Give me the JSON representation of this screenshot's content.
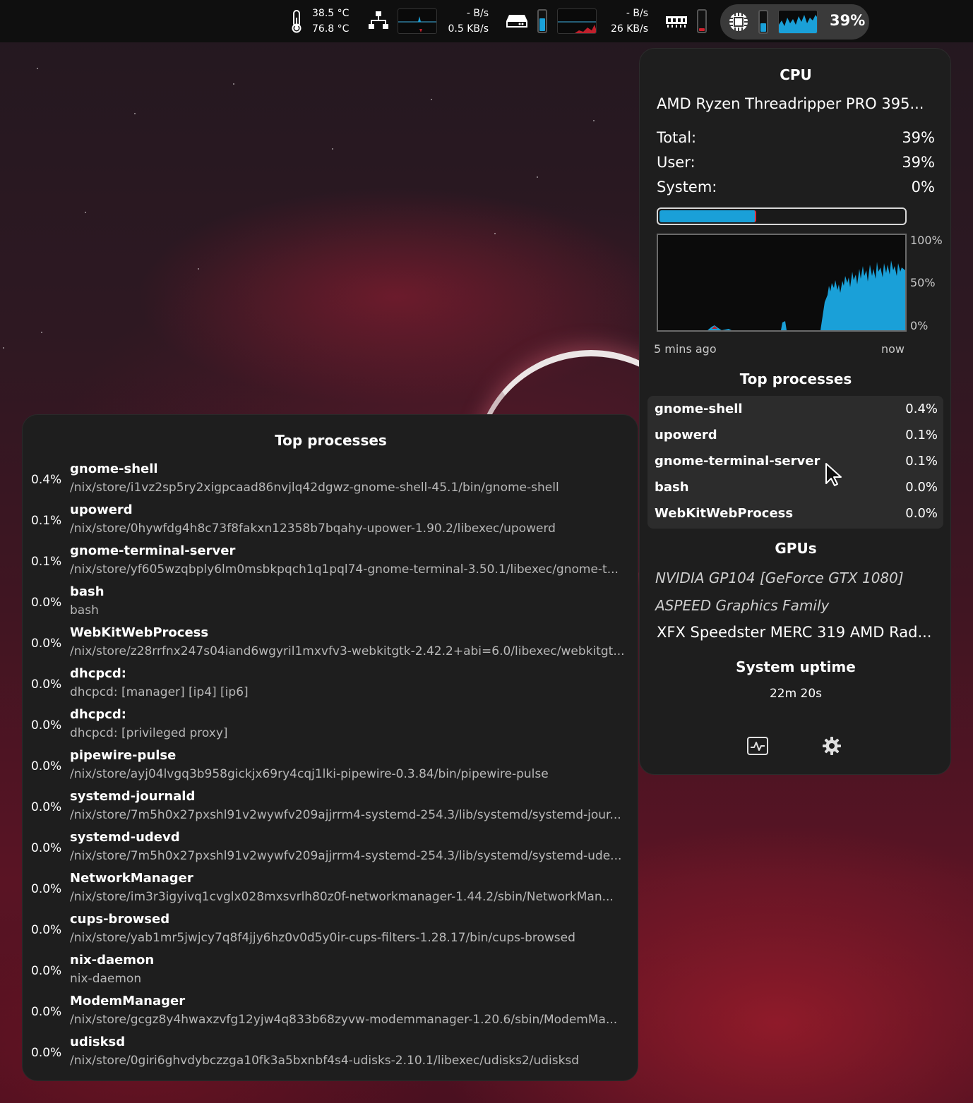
{
  "topbar": {
    "temp1": "38.5 °C",
    "temp2": "76.8 °C",
    "net_up": "-  B/s",
    "net_down": "0.5 KB/s",
    "disk_read": "- B/s",
    "disk_write": "26 KB/s",
    "cpu_percent": "39%",
    "memory_fill": 0.35,
    "swap_fill": 0.15,
    "cpu_mini_fill": 0.39,
    "icons": [
      "thermometer-icon",
      "network-icon",
      "disk-icon",
      "memory-icon",
      "cpu-icon"
    ]
  },
  "cpu_panel": {
    "title": "CPU",
    "model": "AMD Ryzen Threadripper PRO 395...",
    "total_label": "Total:",
    "total_value": "39%",
    "user_label": "User:",
    "user_value": "39%",
    "system_label": "System:",
    "system_value": "0%",
    "usage_fraction": 0.39,
    "graph_ylabels": [
      "100%",
      "50%",
      "0%"
    ],
    "graph_xlabel_left": "5 mins ago",
    "graph_xlabel_right": "now",
    "top_title": "Top processes",
    "top": [
      {
        "name": "gnome-shell",
        "pct": "0.4%"
      },
      {
        "name": "upowerd",
        "pct": "0.1%"
      },
      {
        "name": "gnome-terminal-server",
        "pct": "0.1%"
      },
      {
        "name": "bash",
        "pct": "0.0%"
      },
      {
        "name": "WebKitWebProcess",
        "pct": "0.0%"
      }
    ],
    "gpus_title": "GPUs",
    "gpus": [
      "NVIDIA GP104 [GeForce GTX 1080]",
      "ASPEED Graphics Family",
      "XFX Speedster MERC 319 AMD Rad..."
    ],
    "uptime_title": "System uptime",
    "uptime_value": "22m 20s",
    "accent": "#1aa0d8"
  },
  "processes": {
    "title": "Top processes",
    "items": [
      {
        "pct": "0.4%",
        "name": "gnome-shell",
        "path": "/nix/store/i1vz2sp5ry2xigpcaad86nvjlq42dgwz-gnome-shell-45.1/bin/gnome-shell"
      },
      {
        "pct": "0.1%",
        "name": "upowerd",
        "path": "/nix/store/0hywfdg4h8c73f8fakxn12358b7bqahy-upower-1.90.2/libexec/upowerd"
      },
      {
        "pct": "0.1%",
        "name": "gnome-terminal-server",
        "path": "/nix/store/yf605wzqbply6lm0msbkpqch1q1pql74-gnome-terminal-3.50.1/libexec/gnome-t..."
      },
      {
        "pct": "0.0%",
        "name": "bash",
        "path": "bash"
      },
      {
        "pct": "0.0%",
        "name": "WebKitWebProcess",
        "path": "/nix/store/z28rrfnx247s04iand6wgyril1mxvfv3-webkitgtk-2.42.2+abi=6.0/libexec/webkitgt..."
      },
      {
        "pct": "0.0%",
        "name": "dhcpcd:",
        "path": "dhcpcd: [manager] [ip4] [ip6]"
      },
      {
        "pct": "0.0%",
        "name": "dhcpcd:",
        "path": "dhcpcd: [privileged proxy]"
      },
      {
        "pct": "0.0%",
        "name": "pipewire-pulse",
        "path": "/nix/store/ayj04lvgq3b958gickjx69ry4cqj1lki-pipewire-0.3.84/bin/pipewire-pulse"
      },
      {
        "pct": "0.0%",
        "name": "systemd-journald",
        "path": "/nix/store/7m5h0x27pxshl91v2wywfv209ajjrrm4-systemd-254.3/lib/systemd/systemd-jour..."
      },
      {
        "pct": "0.0%",
        "name": "systemd-udevd",
        "path": "/nix/store/7m5h0x27pxshl91v2wywfv209ajjrrm4-systemd-254.3/lib/systemd/systemd-ude..."
      },
      {
        "pct": "0.0%",
        "name": "NetworkManager",
        "path": "/nix/store/im3r3igyivq1cvglx028mxsvrlh80z0f-networkmanager-1.44.2/sbin/NetworkMan..."
      },
      {
        "pct": "0.0%",
        "name": "cups-browsed",
        "path": "/nix/store/yab1mr5jwjcy7q8f4jjy6hz0v0d5y0ir-cups-filters-1.28.17/bin/cups-browsed"
      },
      {
        "pct": "0.0%",
        "name": "nix-daemon",
        "path": "nix-daemon"
      },
      {
        "pct": "0.0%",
        "name": "ModemManager",
        "path": "/nix/store/gcgz8y4hwaxzvfg12yjw4q833b68zyvw-modemmanager-1.20.6/sbin/ModemMa..."
      },
      {
        "pct": "0.0%",
        "name": "udisksd",
        "path": "/nix/store/0giri6ghvdybczzga10fk3a5bxnbf4s4-udisks-2.10.1/libexec/udisks2/udisksd"
      }
    ]
  }
}
